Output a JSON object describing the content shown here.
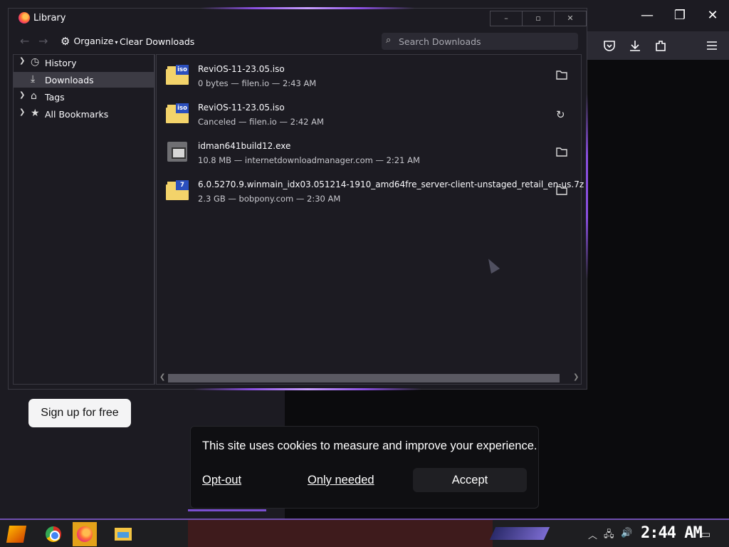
{
  "browser": {
    "minimize_glyph": "—",
    "restore_glyph": "❐",
    "close_glyph": "✕"
  },
  "library": {
    "title": "Library",
    "controls": {
      "minimize": "–",
      "maximize": "▫",
      "close": "✕"
    },
    "toolbar": {
      "back_glyph": "←",
      "forward_glyph": "→",
      "organize_label": "Organize",
      "clear_label": "Clear Downloads",
      "search_placeholder": "Search Downloads"
    },
    "sidebar": [
      {
        "label": "History",
        "icon": "clock-icon",
        "glyph": "◷",
        "expandable": true,
        "selected": false
      },
      {
        "label": "Downloads",
        "icon": "download-icon",
        "glyph": "⤓",
        "expandable": false,
        "selected": true
      },
      {
        "label": "Tags",
        "icon": "tag-icon",
        "glyph": "⌂",
        "expandable": true,
        "selected": false
      },
      {
        "label": "All Bookmarks",
        "icon": "star-icon",
        "glyph": "★",
        "expandable": true,
        "selected": false
      }
    ],
    "downloads": [
      {
        "name": "ReviOS-11-23.05.iso",
        "status": "0 bytes — filen.io — 2:43 AM",
        "file_icon": "iso",
        "tag": "iso",
        "action": "folder"
      },
      {
        "name": "ReviOS-11-23.05.iso",
        "status": "Canceled — filen.io — 2:42 AM",
        "file_icon": "iso",
        "tag": "iso",
        "action": "retry"
      },
      {
        "name": "idman641build12.exe",
        "status": "10.8 MB — internetdownloadmanager.com — 2:21 AM",
        "file_icon": "exe",
        "tag": "",
        "action": "folder"
      },
      {
        "name": "6.0.5270.9.winmain_idx03.051214-1910_amd64fre_server-client-unstaged_retail_en-us.7z",
        "status": "2.3 GB — bobpony.com — 2:30 AM",
        "file_icon": "7z",
        "tag": "7",
        "action": "folder"
      }
    ]
  },
  "page": {
    "signup_label": "Sign up for free",
    "cookie": {
      "message": "This site uses cookies to measure and improve your experience.",
      "opt_out": "Opt-out",
      "only_needed": "Only needed",
      "accept": "Accept"
    }
  },
  "taskbar": {
    "clock": "2:44 AM",
    "apps": [
      "start",
      "chrome",
      "firefox",
      "file-explorer"
    ]
  }
}
